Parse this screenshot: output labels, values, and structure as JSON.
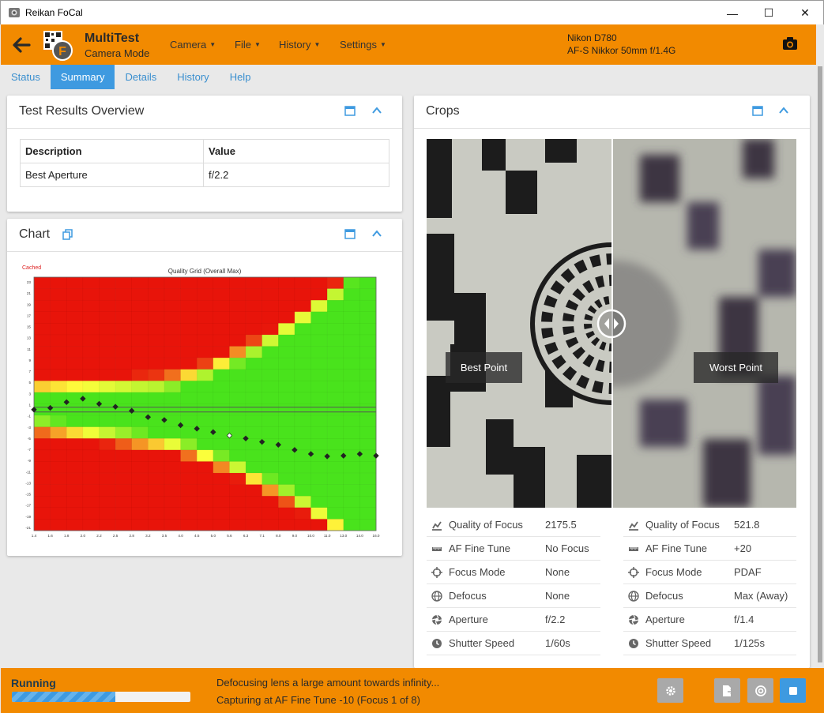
{
  "window": {
    "title": "Reikan FoCal",
    "minimize_glyph": "—",
    "maximize_glyph": "☐",
    "close_glyph": "✕"
  },
  "header": {
    "mode_title": "MultiTest",
    "mode_subtitle": "Camera Mode",
    "menus": [
      "Camera",
      "File",
      "History",
      "Settings"
    ],
    "camera_body": "Nikon D780",
    "lens": "AF-S Nikkor 50mm f/1.4G",
    "accent": "#f28a00"
  },
  "tabs": [
    {
      "label": "Status",
      "active": false
    },
    {
      "label": "Summary",
      "active": true
    },
    {
      "label": "Details",
      "active": false
    },
    {
      "label": "History",
      "active": false
    },
    {
      "label": "Help",
      "active": false
    }
  ],
  "overview": {
    "title": "Test Results Overview",
    "columns": [
      "Description",
      "Value"
    ],
    "rows": [
      {
        "description": "Best Aperture",
        "value": "f/2.2"
      }
    ]
  },
  "chart_panel": {
    "title": "Chart",
    "cached_label": "Cached"
  },
  "chart_data": {
    "type": "heatmap",
    "title": "Quality Grid (Overall Max)",
    "y_ticks": [
      "23",
      "21",
      "19",
      "17",
      "15",
      "13",
      "11",
      "9",
      "7",
      "5",
      "3",
      "1",
      "-1",
      "-3",
      "-5",
      "-7",
      "-9",
      "-11",
      "-13",
      "-15",
      "-17",
      "-19",
      "-21"
    ],
    "x_ticks": [
      "1.4",
      "1.6",
      "1.8",
      "2.0",
      "2.2",
      "2.5",
      "2.8",
      "3.2",
      "3.5",
      "4.0",
      "4.5",
      "5.0",
      "5.6",
      "6.3",
      "7.1",
      "8.0",
      "9.0",
      "10.0",
      "11.0",
      "13.0",
      "14.0",
      "16.0"
    ],
    "x_range": [
      1.4,
      16.0
    ],
    "y_range": [
      -21,
      23
    ],
    "zero_line": 0,
    "color_scale": {
      "low": "#e8140a",
      "mid": "#ffff3c",
      "high": "#49e31c"
    },
    "markers": [
      {
        "x": 1.4,
        "y": 0
      },
      {
        "x": 1.6,
        "y": 0.3
      },
      {
        "x": 1.8,
        "y": 1.3
      },
      {
        "x": 2.0,
        "y": 1.9
      },
      {
        "x": 2.2,
        "y": 1.0
      },
      {
        "x": 2.5,
        "y": 0.5
      },
      {
        "x": 2.8,
        "y": -0.2
      },
      {
        "x": 3.2,
        "y": -1.3
      },
      {
        "x": 3.5,
        "y": -1.8
      },
      {
        "x": 4.0,
        "y": -2.7
      },
      {
        "x": 4.5,
        "y": -3.3
      },
      {
        "x": 5.0,
        "y": -3.9
      },
      {
        "x": 5.6,
        "y": -4.5,
        "highlight": true
      },
      {
        "x": 6.3,
        "y": -5.0
      },
      {
        "x": 7.1,
        "y": -5.6
      },
      {
        "x": 8.0,
        "y": -6.1
      },
      {
        "x": 9.0,
        "y": -7.0
      },
      {
        "x": 10.0,
        "y": -7.7
      },
      {
        "x": 11.0,
        "y": -8.1
      },
      {
        "x": 13.0,
        "y": -8.0
      },
      {
        "x": 14.0,
        "y": -7.7
      },
      {
        "x": 16.0,
        "y": -8.0
      }
    ]
  },
  "crops": {
    "title": "Crops",
    "best_label": "Best Point",
    "worst_label": "Worst Point",
    "best": [
      {
        "icon": "quality-chart-icon",
        "label": "Quality of Focus",
        "value": "2175.5"
      },
      {
        "icon": "ruler-icon",
        "label": "AF Fine Tune",
        "value": "No Focus"
      },
      {
        "icon": "crosshair-icon",
        "label": "Focus Mode",
        "value": "None"
      },
      {
        "icon": "globe-icon",
        "label": "Defocus",
        "value": "None"
      },
      {
        "icon": "aperture-icon",
        "label": "Aperture",
        "value": "f/2.2"
      },
      {
        "icon": "clock-icon",
        "label": "Shutter Speed",
        "value": "1/60s"
      }
    ],
    "worst": [
      {
        "icon": "quality-chart-icon",
        "label": "Quality of Focus",
        "value": "521.8"
      },
      {
        "icon": "ruler-icon",
        "label": "AF Fine Tune",
        "value": "+20"
      },
      {
        "icon": "crosshair-icon",
        "label": "Focus Mode",
        "value": "PDAF"
      },
      {
        "icon": "globe-icon",
        "label": "Defocus",
        "value": "Max (Away)"
      },
      {
        "icon": "aperture-icon",
        "label": "Aperture",
        "value": "f/1.4"
      },
      {
        "icon": "clock-icon",
        "label": "Shutter Speed",
        "value": "1/125s"
      }
    ]
  },
  "status_bar": {
    "state": "Running",
    "progress": 0.58,
    "line1": "Defocusing lens a large amount towards infinity...",
    "line2": "Capturing at AF Fine Tune -10 (Focus 1 of 8)"
  }
}
